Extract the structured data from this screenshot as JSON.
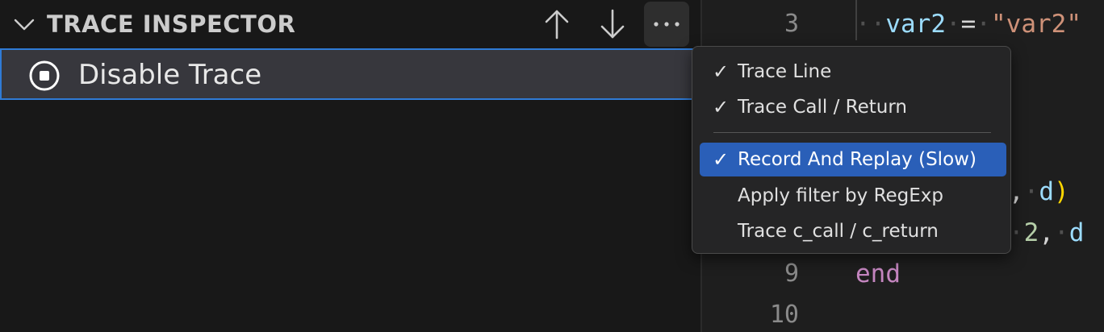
{
  "panel": {
    "title": "TRACE INSPECTOR",
    "actions": {
      "up": "Move Up",
      "down": "Move Down",
      "more": "More Actions"
    },
    "trace_item": {
      "label": "Disable Trace"
    }
  },
  "menu": {
    "items": [
      {
        "label": "Trace Line",
        "checked": true,
        "active": false
      },
      {
        "label": "Trace Call / Return",
        "checked": true,
        "active": false
      },
      {
        "label": "Record And Replay (Slow)",
        "checked": true,
        "active": true
      },
      {
        "label": "Apply filter by RegExp",
        "checked": false,
        "active": false
      },
      {
        "label": "Trace c_call / c_return",
        "checked": false,
        "active": false
      }
    ],
    "check_glyph": "✓"
  },
  "editor": {
    "line_numbers": [
      "3",
      "9",
      "10"
    ],
    "line3": {
      "ident": "var2",
      "op": "=",
      "string": "\"var2\""
    },
    "line7": {
      "sep": ",",
      "ident": "d",
      "paren": ")"
    },
    "line8": {
      "num": "2",
      "sep": ",",
      "ident": "d"
    },
    "line9": {
      "keyword": "end"
    }
  },
  "colors": {
    "accent_border": "#2f7bd6",
    "menu_highlight": "#2a5fb8",
    "string": "#ce9178",
    "identifier": "#9cdcfe",
    "keyword": "#c586c0"
  }
}
